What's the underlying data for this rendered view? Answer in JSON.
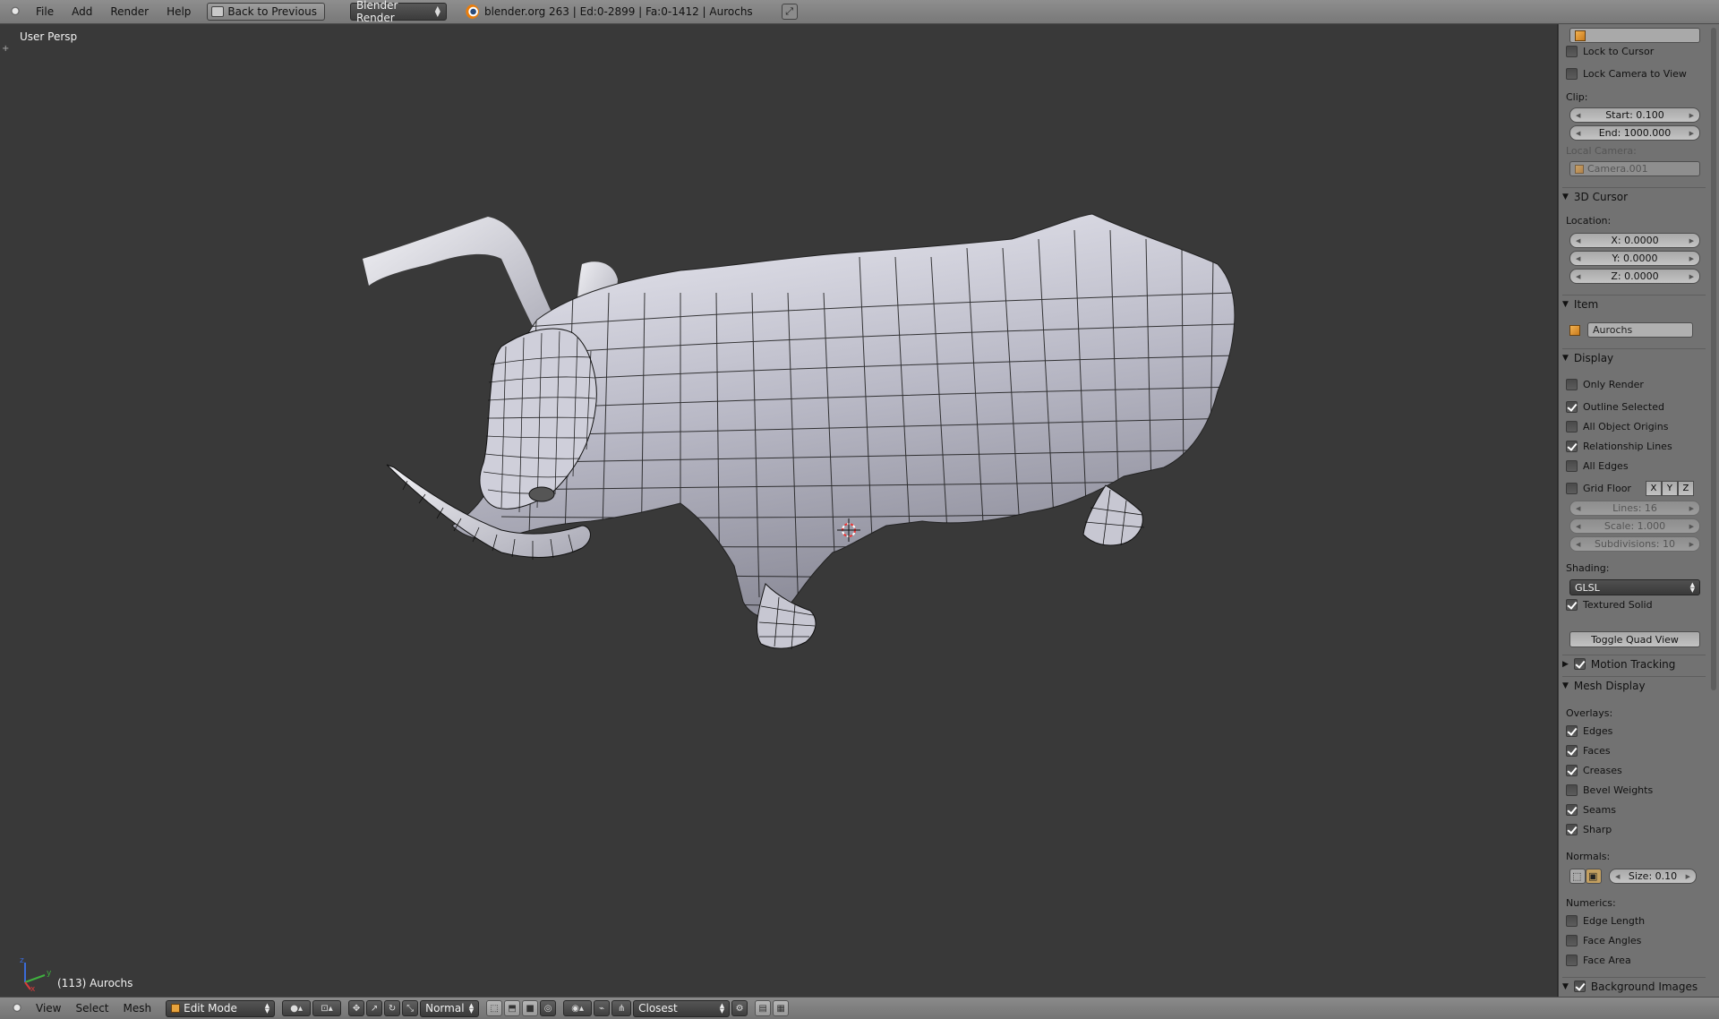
{
  "header": {
    "menus": [
      "File",
      "Add",
      "Render",
      "Help"
    ],
    "back_button": "Back to Previous",
    "render_engine": "Blender Render",
    "stats": "blender.org 263 | Ed:0-2899 | Fa:0-1412 | Aurochs"
  },
  "viewport": {
    "view_label": "User Persp",
    "object_label": "(113) Aurochs",
    "axis_labels": {
      "x": "x",
      "y": "y",
      "z": "z"
    }
  },
  "properties": {
    "lock_to_cursor": "Lock to Cursor",
    "lock_camera_to_view": "Lock Camera to View",
    "clip_label": "Clip:",
    "clip_start": "Start: 0.100",
    "clip_end": "End: 1000.000",
    "local_camera_label": "Local Camera:",
    "local_camera_value": "Camera.001",
    "cursor_panel": "3D Cursor",
    "location_label": "Location:",
    "cursor_x": "X: 0.0000",
    "cursor_y": "Y: 0.0000",
    "cursor_z": "Z: 0.0000",
    "item_panel": "Item",
    "item_name": "Aurochs",
    "display_panel": "Display",
    "only_render": "Only Render",
    "outline_selected": "Outline Selected",
    "all_object_origins": "All Object Origins",
    "relationship_lines": "Relationship Lines",
    "all_edges": "All Edges",
    "grid_floor": "Grid Floor",
    "grid_axes": [
      "X",
      "Y",
      "Z"
    ],
    "lines": "Lines: 16",
    "scale": "Scale: 1.000",
    "subdivisions": "Subdivisions: 10",
    "shading_label": "Shading:",
    "shading_value": "GLSL",
    "textured_solid": "Textured Solid",
    "toggle_quad_view": "Toggle Quad View",
    "motion_tracking_panel": "Motion Tracking",
    "mesh_display_panel": "Mesh Display",
    "overlays_label": "Overlays:",
    "edges": "Edges",
    "faces": "Faces",
    "creases": "Creases",
    "bevel_weights": "Bevel Weights",
    "seams": "Seams",
    "sharp": "Sharp",
    "normals_label": "Normals:",
    "normals_size": "Size: 0.10",
    "numerics_label": "Numerics:",
    "edge_length": "Edge Length",
    "face_angles": "Face Angles",
    "face_area": "Face Area",
    "background_images_panel": "Background Images"
  },
  "footer": {
    "menus": [
      "View",
      "Select",
      "Mesh"
    ],
    "mode": "Edit Mode",
    "pivot_orientation": "Normal",
    "snap_target": "Closest"
  },
  "colors": {
    "viewport_bg": "#393939",
    "mesh_fill": "#c8c8d2",
    "wire": "#111111",
    "panel_bg": "#727272"
  }
}
